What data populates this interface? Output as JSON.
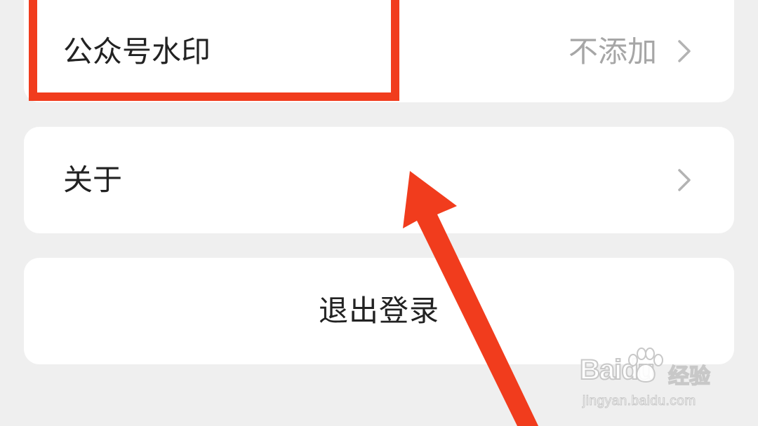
{
  "settings": {
    "items": [
      {
        "label": "公众号水印",
        "value": "不添加"
      },
      {
        "label": "关于",
        "value": ""
      }
    ],
    "logout_label": "退出登录"
  },
  "annotation": {
    "highlight_color": "#f13c1d",
    "arrow_color": "#f13c1d"
  },
  "watermark": {
    "brand": "Baidu",
    "product": "经验",
    "url": "jingyan.baidu.com"
  },
  "icons": {
    "chevron": "chevron-right-icon",
    "paw": "baidu-paw-icon"
  }
}
